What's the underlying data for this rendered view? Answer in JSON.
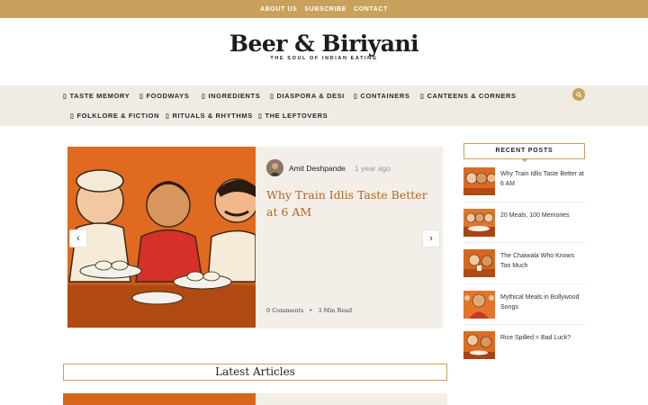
{
  "topbar": {
    "links": [
      "ABOUT US",
      "SUBSCRIBE",
      "CONTACT"
    ]
  },
  "brand": {
    "name": "Beer & Biriyani",
    "tagline": "THE SOUL OF INDIAN EATING"
  },
  "nav": {
    "items": [
      "TASTE MEMORY",
      "FOODWAYS",
      "INGREDIENTS",
      "DIASPORA & DESI",
      "CONTAINERS",
      "CANTEENS & CORNERS",
      "FOLKLORE & FICTION",
      "RITUALS & RHYTHMS",
      "THE LEFTOVERS"
    ],
    "item_icon": "tag-icon",
    "search_icon": "search-icon"
  },
  "hero": {
    "author": "Amit Deshpande",
    "time_ago": "1 year ago",
    "title": "Why Train Idlis Taste Better at 6 AM",
    "comments": "0 Comments",
    "separator": "•",
    "read_time": "3 Min Read",
    "prev_icon": "‹",
    "next_icon": "›"
  },
  "latest": {
    "heading": "Latest Articles"
  },
  "sidebar": {
    "heading": "RECENT POSTS",
    "posts": [
      {
        "title": "Why Train Idlis Taste Better at 6 AM"
      },
      {
        "title": "20 Meals, 100 Memories"
      },
      {
        "title": "The Chaiwala Who Knows Too Much"
      },
      {
        "title": "Mythical Meals in Bollywood Songs"
      },
      {
        "title": "Rice Spilled = Bad Luck?"
      }
    ]
  },
  "colors": {
    "accent": "#c8a15c",
    "title": "#b5651d",
    "nav_bg": "#f0ebe3"
  }
}
